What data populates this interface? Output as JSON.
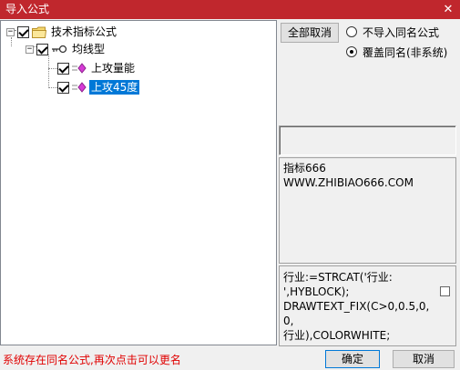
{
  "window": {
    "title": "导入公式",
    "close_glyph": "✕"
  },
  "tree": {
    "root": {
      "label": "技术指标公式",
      "checked": true,
      "expander": "−"
    },
    "group": {
      "label": "均线型",
      "checked": true,
      "expander": "−"
    },
    "items": [
      {
        "label": "上攻量能",
        "checked": true,
        "selected": false
      },
      {
        "label": "上攻45度",
        "checked": true,
        "selected": true
      }
    ]
  },
  "options": {
    "cancel_all_label": "全部取消",
    "radio_no_import": "不导入同名公式",
    "radio_overwrite": "覆盖同名(非系统)",
    "selected_radio": "overwrite"
  },
  "description": {
    "lines": [
      "指标666",
      "WWW.ZHIBIAO666.COM"
    ]
  },
  "code": {
    "text": "行业:=STRCAT('行业:\n',HYBLOCK);\nDRAWTEXT_FIX(C>0,0.5,0,0,\n行业),COLORWHITE;"
  },
  "status": {
    "message": "系统存在同名公式,再次点击可以更名"
  },
  "footer": {
    "ok_label": "确定",
    "cancel_label": "取消"
  },
  "colors": {
    "title_bar": "#c0272d",
    "selection": "#0078d7",
    "status_text": "#e00000"
  }
}
